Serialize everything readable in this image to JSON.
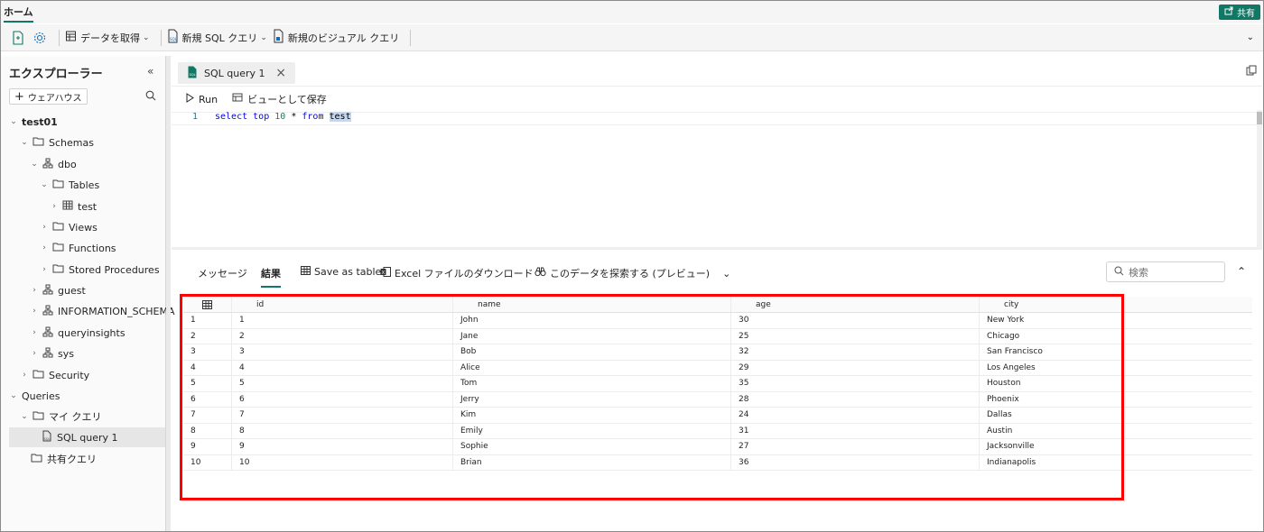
{
  "top": {
    "home_tab": "ホーム",
    "share_label": "共有",
    "accent_color": "#117865"
  },
  "ribbon": {
    "get_data": "データを取得",
    "new_sql_query": "新規 SQL クエリ",
    "new_visual_query": "新規のビジュアル クエリ"
  },
  "sidebar": {
    "title": "エクスプローラー",
    "warehouse_button": "ウェアハウス",
    "items": [
      {
        "label": "test01"
      },
      {
        "label": "Schemas"
      },
      {
        "label": "dbo"
      },
      {
        "label": "Tables"
      },
      {
        "label": "test"
      },
      {
        "label": "Views"
      },
      {
        "label": "Functions"
      },
      {
        "label": "Stored Procedures"
      },
      {
        "label": "guest"
      },
      {
        "label": "INFORMATION_SCHEMA"
      },
      {
        "label": "queryinsights"
      },
      {
        "label": "sys"
      },
      {
        "label": "Security"
      },
      {
        "label": "Queries"
      },
      {
        "label": "マイ クエリ"
      },
      {
        "label": "SQL query 1"
      },
      {
        "label": "共有クエリ"
      }
    ]
  },
  "editor": {
    "tab_label": "SQL query 1",
    "run_label": "Run",
    "save_as_view": "ビューとして保存",
    "line_number": "1",
    "code": {
      "kw1": "select",
      "kw2": "top",
      "num": "10",
      "star": "*",
      "kw3": "from",
      "ident": "test"
    }
  },
  "results": {
    "tabs": {
      "messages": "メッセージ",
      "results": "結果",
      "save_as_table": "Save as table",
      "excel_download": "Excel ファイルのダウンロード",
      "explore": "このデータを探索する (プレビュー)"
    },
    "search_placeholder": "検索",
    "columns": [
      "id",
      "name",
      "age",
      "city"
    ],
    "rows": [
      [
        "1",
        "1",
        "John",
        "30",
        "New York"
      ],
      [
        "2",
        "2",
        "Jane",
        "25",
        "Chicago"
      ],
      [
        "3",
        "3",
        "Bob",
        "32",
        "San Francisco"
      ],
      [
        "4",
        "4",
        "Alice",
        "29",
        "Los Angeles"
      ],
      [
        "5",
        "5",
        "Tom",
        "35",
        "Houston"
      ],
      [
        "6",
        "6",
        "Jerry",
        "28",
        "Phoenix"
      ],
      [
        "7",
        "7",
        "Kim",
        "24",
        "Dallas"
      ],
      [
        "8",
        "8",
        "Emily",
        "31",
        "Austin"
      ],
      [
        "9",
        "9",
        "Sophie",
        "27",
        "Jacksonville"
      ],
      [
        "10",
        "10",
        "Brian",
        "36",
        "Indianapolis"
      ]
    ]
  },
  "highlight_color": "#ff0000"
}
